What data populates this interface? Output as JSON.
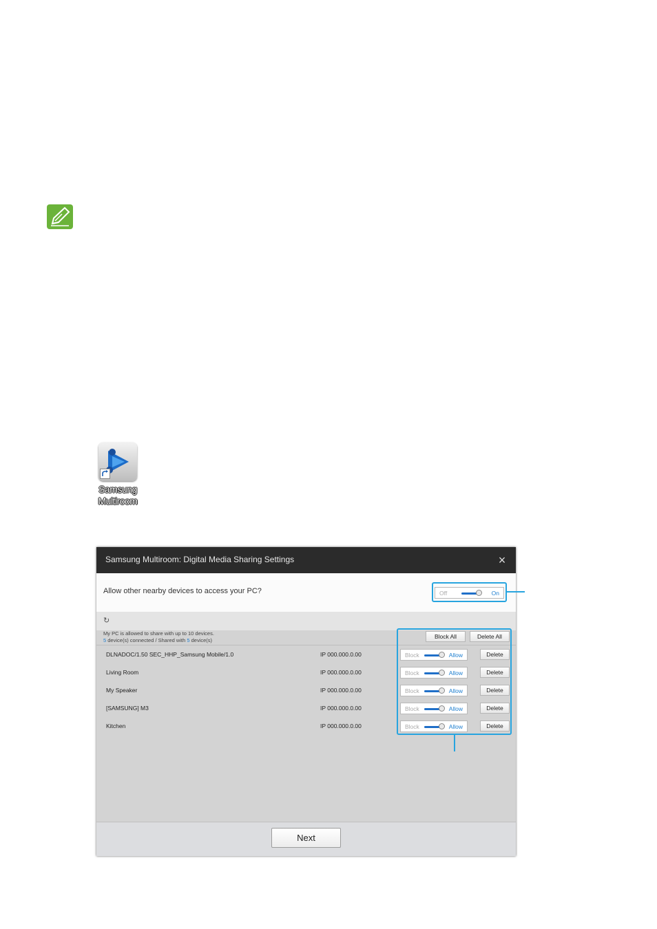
{
  "desktop_icon": {
    "label": "Samsung Multiroom"
  },
  "dialog": {
    "title": "Samsung Multiroom: Digital Media Sharing Settings",
    "close_glyph": "×",
    "access_question": "Allow other nearby devices to access your PC?",
    "access_toggle": {
      "off_label": "Off",
      "on_label": "On",
      "state": "On"
    },
    "refresh_icon": "refresh-icon",
    "info_line1": "My PC is allowed to share with up to 10 devices.",
    "connected_count": "5",
    "connected_text": "device(s) connected / Shared with",
    "shared_count": "5",
    "shared_text": "device(s)",
    "block_all_label": "Block All",
    "delete_all_label": "Delete All",
    "devices": [
      {
        "name": "DLNADOC/1.50 SEC_HHP_Samsung Mobile/1.0",
        "ip": "IP 000.000.0.00",
        "block_label": "Block",
        "allow_label": "Allow",
        "state": "Allow",
        "delete_label": "Delete"
      },
      {
        "name": "Living Room",
        "ip": "IP 000.000.0.00",
        "block_label": "Block",
        "allow_label": "Allow",
        "state": "Allow",
        "delete_label": "Delete"
      },
      {
        "name": "My Speaker",
        "ip": "IP 000.000.0.00",
        "block_label": "Block",
        "allow_label": "Allow",
        "state": "Allow",
        "delete_label": "Delete"
      },
      {
        "name": "[SAMSUNG] M3",
        "ip": "IP 000.000.0.00",
        "block_label": "Block",
        "allow_label": "Allow",
        "state": "Allow",
        "delete_label": "Delete"
      },
      {
        "name": "Kitchen",
        "ip": "IP 000.000.0.00",
        "block_label": "Block",
        "allow_label": "Allow",
        "state": "Allow",
        "delete_label": "Delete"
      }
    ],
    "next_label": "Next"
  },
  "colors": {
    "callout": "#27a4df",
    "accent_blue": "#1f7fd0",
    "note_green": "#6bb33a",
    "titlebar": "#2b2b2b"
  }
}
